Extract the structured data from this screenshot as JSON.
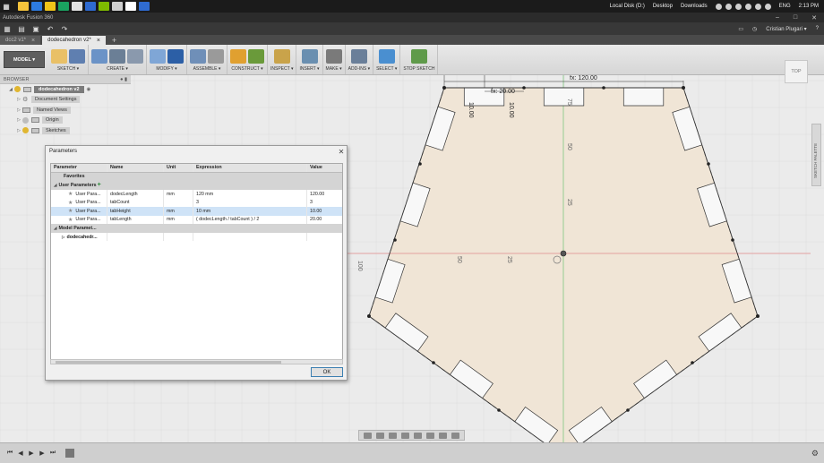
{
  "taskbar": {
    "drive_label": "Local Disk (D:)",
    "desktop_label": "Desktop",
    "downloads_label": "Downloads",
    "language": "ENG",
    "time": "2:13 PM",
    "app_icons": [
      "#f5c33b",
      "#2d7be0",
      "#f0c419",
      "#1aa260",
      "#e0e0e0",
      "#2f6bd1",
      "#7fba00",
      "#cfcfcf",
      "#ffffff",
      "#2f6bd1"
    ]
  },
  "app": {
    "title": "Autodesk Fusion 360",
    "user": "Cristian Plugari ▾"
  },
  "tabs": [
    {
      "label": "dcc2 v1*",
      "active": false
    },
    {
      "label": "dodecahedron v2*",
      "active": true
    }
  ],
  "toolbar": {
    "workspace": "MODEL ▾",
    "groups": [
      {
        "label": "SKETCH ▾",
        "colors": [
          "#e9c067",
          "#5f7fb0"
        ]
      },
      {
        "label": "CREATE ▾",
        "colors": [
          "#6b93c7",
          "#6b7f96",
          "#8a99ad"
        ]
      },
      {
        "label": "MODIFY ▾",
        "colors": [
          "#7fa6d6",
          "#2c5fa6"
        ]
      },
      {
        "label": "ASSEMBLE ▾",
        "colors": [
          "#6f8fb8",
          "#9a9a9a"
        ]
      },
      {
        "label": "CONSTRUCT ▾",
        "colors": [
          "#e0a030",
          "#6a9a3a"
        ]
      },
      {
        "label": "INSPECT ▾",
        "colors": [
          "#c9a34a"
        ]
      },
      {
        "label": "INSERT ▾",
        "colors": [
          "#6a8fb0"
        ]
      },
      {
        "label": "MAKE ▾",
        "colors": [
          "#7a7a7a"
        ]
      },
      {
        "label": "ADD-INS ▾",
        "colors": [
          "#6a7f99"
        ]
      },
      {
        "label": "SELECT ▾",
        "colors": [
          "#4a8fd0"
        ]
      },
      {
        "label": "STOP SKETCH",
        "colors": [
          "#5f9a4a"
        ]
      }
    ]
  },
  "browser": {
    "title": "BROWSER",
    "root": "dodecahedron v2",
    "items": [
      "Document Settings",
      "Named Views",
      "Origin",
      "Sketches"
    ]
  },
  "viewcube": {
    "label": "TOP"
  },
  "sketch_palette": {
    "label": "SKETCH PALETTE"
  },
  "sketch": {
    "dim_fx_20": "fx: 20.00",
    "dim_fx_120": "fx: 120.00",
    "dim_fx_20b": "fx: 20.00",
    "dim_10a": "10.00",
    "dim_10b": "10.00",
    "axis_labels": [
      "100",
      "50",
      "25",
      "25",
      "50",
      "75",
      "100"
    ]
  },
  "dialog": {
    "title": "Parameters",
    "columns": [
      "Parameter",
      "Name",
      "Unit",
      "Expression",
      "Value"
    ],
    "favorites": "Favorites",
    "user_group": "User Parameters",
    "rows": [
      {
        "param": "User Para...",
        "name": "dodecLength",
        "unit": "mm",
        "expr": "120 mm",
        "value": "120.00",
        "selected": false
      },
      {
        "param": "User Para...",
        "name": "tabCount",
        "unit": "",
        "expr": "3",
        "value": "3",
        "selected": false
      },
      {
        "param": "User Para...",
        "name": "tabHeight",
        "unit": "mm",
        "expr": "10 mm",
        "value": "10.00",
        "selected": true
      },
      {
        "param": "User Para...",
        "name": "tabLength",
        "unit": "mm",
        "expr": "( dodecLength / tabCount ) / 2",
        "value": "20.00",
        "selected": false
      }
    ],
    "model_group": "Model Paramet...",
    "model_child": "dodecahedr...",
    "ok": "OK"
  }
}
